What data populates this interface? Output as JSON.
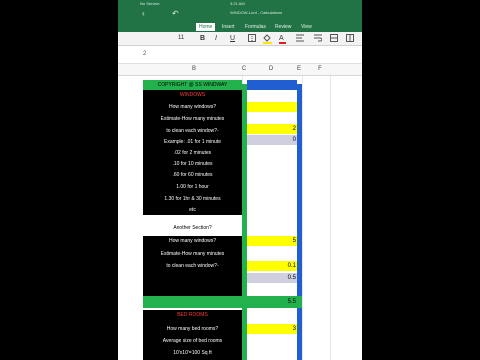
{
  "app": {
    "carrier": "No Service",
    "time": "3:21 AM",
    "doc_title": "WINDOW-Lord - Calculations",
    "nav_back": "‹",
    "nav_undo": "↶"
  },
  "tabs": [
    {
      "label": "Home",
      "active": true
    },
    {
      "label": "Insert",
      "active": false
    },
    {
      "label": "Formulas",
      "active": false
    },
    {
      "label": "Review",
      "active": false
    },
    {
      "label": "View",
      "active": false
    }
  ],
  "ribbon": {
    "font_size": "11",
    "bold": "B",
    "italic": "I",
    "underline": "U",
    "fill_icon": "paint-bucket",
    "font_color_letter": "A"
  },
  "formula_bar": {
    "cell_ref": "2"
  },
  "columns": [
    "B",
    "C",
    "D",
    "E",
    "F"
  ],
  "rows": {
    "copyright": "COPYRIGHT @ SS WINDWAY",
    "section1_title": "WINDOWS",
    "q_how_many": "How many windows?",
    "q_estimate": "Estimate-How many minutes",
    "q_to_clean": "to clean each window?-",
    "example": "Example: .01 for 1 minute",
    "ex_02": ".02 for 2 minutes",
    "ex_10": ".10 for 10 minutes",
    "ex_60": ".60 for 60 minutes",
    "ex_100": "1.00 for 1 hour",
    "ex_130": "1.30 for 1hr & 30 minutes",
    "etc": "etc",
    "another": "Another Section?",
    "q2_how_many": "How many windows?",
    "q2_estimate": "Estimate-How many minutes",
    "q2_to_clean": "to clean each window?-",
    "section2_title": "BED ROOMS",
    "q_bed_rooms": "How many bed rooms?",
    "avg_size": "Average size of bed rooms",
    "dims": "10'x10'=100 Sq ft"
  },
  "values": {
    "d_row4": "2",
    "d_row5": "0",
    "d_row_another_count": "5",
    "d_row_another_min": "0.1",
    "d_row_another_sum": "0.5",
    "d_total": "5.5",
    "d_bed_rooms": "3"
  },
  "colors": {
    "excel_green": "#217346",
    "cell_yellow": "#ffff00",
    "cell_green": "#22b14c",
    "border_blue": "#1f5fd1"
  }
}
